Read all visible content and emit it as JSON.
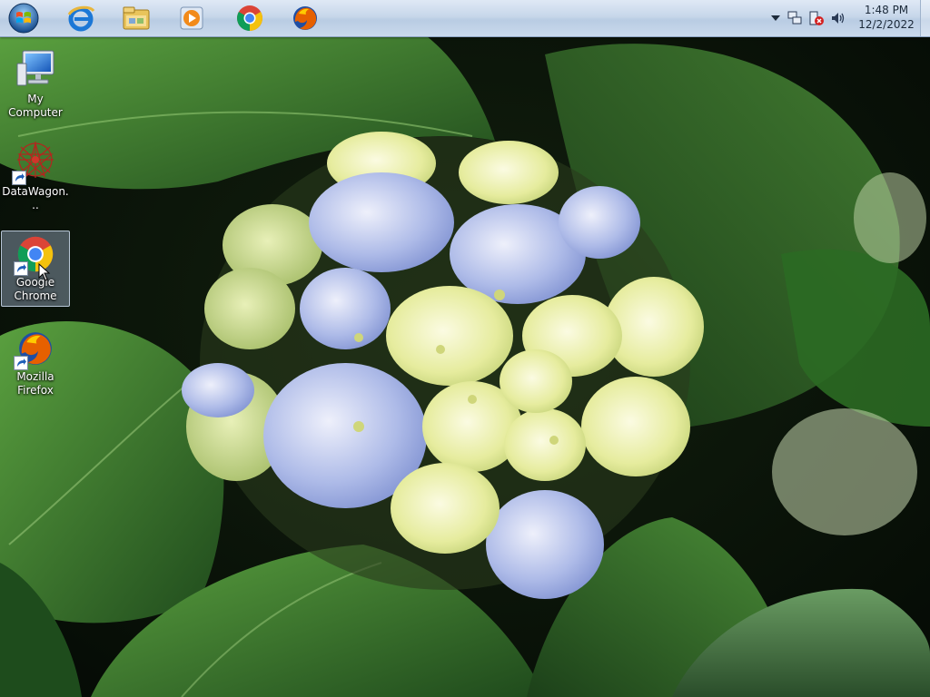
{
  "taskbar": {
    "start_icon": "windows-orb-icon",
    "pinned": [
      {
        "name": "internet-explorer",
        "icon": "ie-icon"
      },
      {
        "name": "file-explorer",
        "icon": "folder-icon"
      },
      {
        "name": "media-player",
        "icon": "media-player-icon"
      },
      {
        "name": "google-chrome",
        "icon": "chrome-icon"
      },
      {
        "name": "mozilla-firefox",
        "icon": "firefox-icon"
      }
    ],
    "tray": {
      "icons": [
        "chevron-up-icon",
        "network-icon",
        "action-center-icon",
        "volume-icon"
      ],
      "time": "1:48 PM",
      "date": "12/2/2022"
    }
  },
  "desktop": {
    "icons": [
      {
        "label": "My Computer",
        "icon": "computer-icon",
        "shortcut": false,
        "selected": false
      },
      {
        "label": "DataWagon...",
        "icon": "datawagon-icon",
        "shortcut": true,
        "selected": false
      },
      {
        "label": "Google Chrome",
        "icon": "chrome-icon",
        "shortcut": true,
        "selected": true
      },
      {
        "label": "Mozilla Firefox",
        "icon": "firefox-icon",
        "shortcut": true,
        "selected": false
      }
    ],
    "wallpaper": "hydrangea-flower-leaves"
  },
  "colors": {
    "taskbar_top": "#dfe9f5",
    "taskbar_bottom": "#b9cce3",
    "leaf_green": "#2f6a2a",
    "petal_blue": "#a9b6e6",
    "petal_cream": "#eef2b8"
  }
}
